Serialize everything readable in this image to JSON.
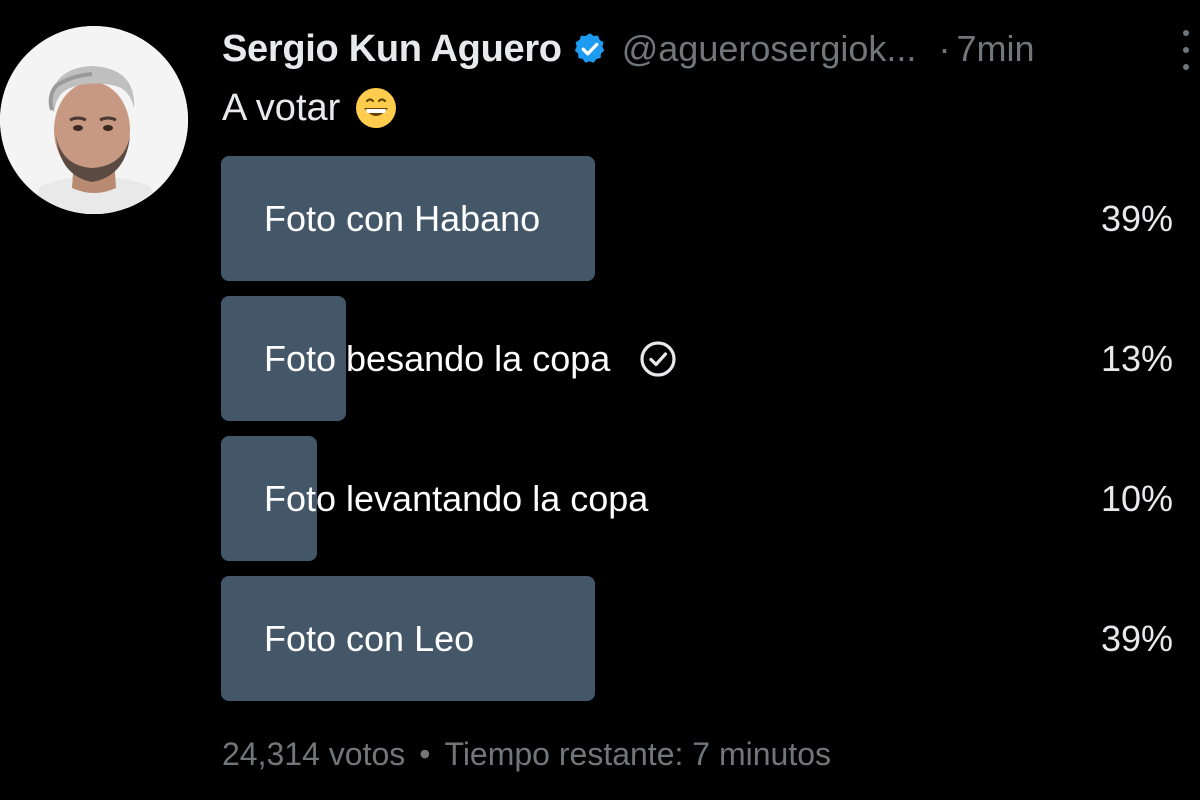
{
  "tweet": {
    "author_name": "Sergio Kun Aguero",
    "handle": "@aguerosergiok...",
    "separator": "·",
    "time": "7min",
    "text": "A votar",
    "emoji": "grinning-face-emoji"
  },
  "poll": {
    "options": [
      {
        "label": "Foto con Habano",
        "percent": "39%",
        "value": 39,
        "selected": false
      },
      {
        "label": "Foto besando la copa",
        "percent": "13%",
        "value": 13,
        "selected": true
      },
      {
        "label": "Foto levantando la copa",
        "percent": "10%",
        "value": 10,
        "selected": false
      },
      {
        "label": "Foto con Leo",
        "percent": "39%",
        "value": 39,
        "selected": false
      }
    ],
    "votes": "24,314 votos",
    "bullet": "•",
    "time_left": "Tiempo restante: 7 minutos"
  },
  "colors": {
    "background": "#000000",
    "bar": "#435769",
    "verified": "#1d9bf0",
    "muted": "#71767b"
  },
  "icons": {
    "verified": "verified-badge-icon",
    "check": "check-circle-icon",
    "more": "more-vertical-icon"
  }
}
